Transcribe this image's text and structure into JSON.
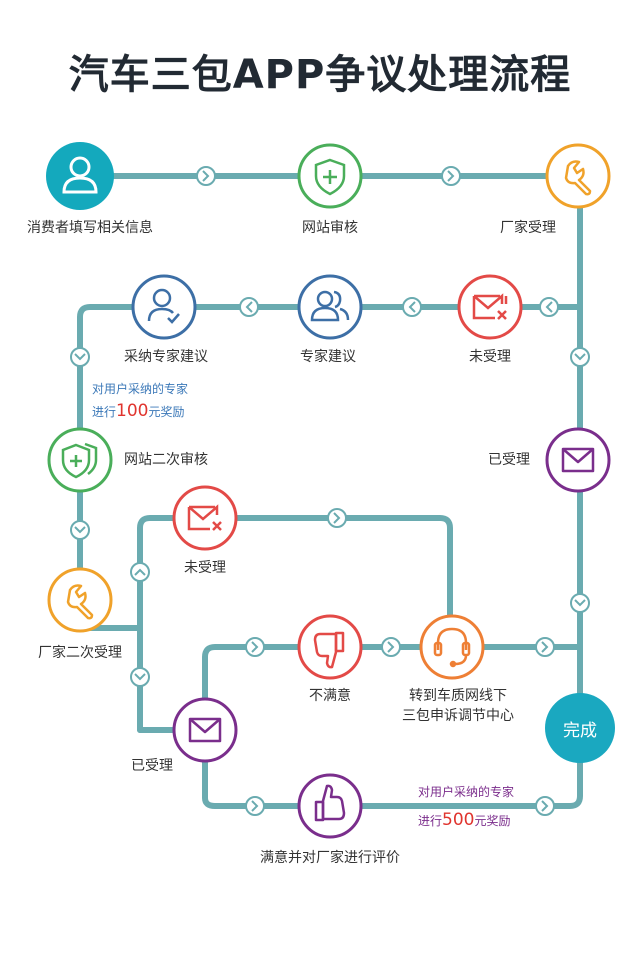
{
  "title": "汽车三包APP争议处理流程",
  "colors": {
    "line": "#6aabb0",
    "teal": "#14a9bd",
    "green": "#4aae5a",
    "orange": "#f0a22a",
    "red": "#e34a47",
    "blue": "#3d6fa6",
    "purple": "#7a2e8c",
    "coral": "#ee7f35"
  },
  "nodes": {
    "fill_info": "消费者填写相关信息",
    "site_review": "网站审核",
    "maker_accept": "厂家受理",
    "not_accepted_1": "未受理",
    "expert_advice": "专家建议",
    "adopt_advice": "采纳专家建议",
    "accepted_1": "已受理",
    "second_review": "网站二次审核",
    "not_accepted_2": "未受理",
    "second_accept": "厂家二次受理",
    "accepted_2": "已受理",
    "unsatisfied": "不满意",
    "transfer_line1": "转到车质网线下",
    "transfer_line2": "三包申诉调节中心",
    "satisfied": "满意并对厂家进行评价",
    "done": "完成"
  },
  "notes": {
    "reward100": {
      "line1": "对用户采纳的专家",
      "pre": "进行",
      "amount": "100",
      "post": "元奖励"
    },
    "reward500": {
      "line1": "对用户采纳的专家",
      "pre": "进行",
      "amount": "500",
      "post": "元奖励"
    }
  },
  "icons": [
    "person-icon",
    "shield-plus-icon",
    "wrench-icon",
    "mail-x-icon",
    "people-icon",
    "person-check-icon",
    "mail-icon",
    "shield-plus-double-icon",
    "thumbs-down-icon",
    "headset-icon",
    "thumbs-up-icon"
  ]
}
